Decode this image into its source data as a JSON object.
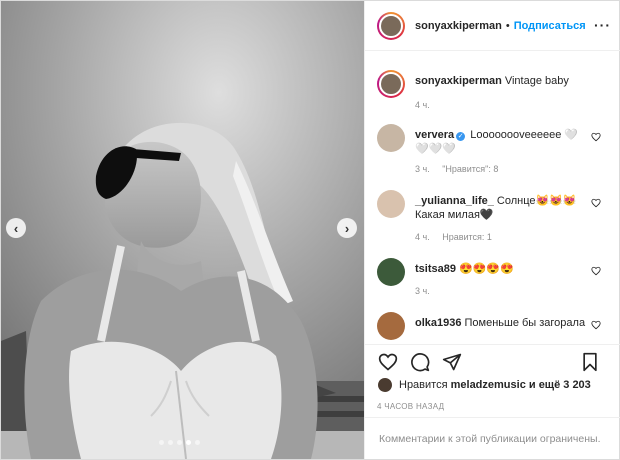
{
  "post": {
    "username": "sonyaxkiperman",
    "separator": "•",
    "follow_label": "Подписаться",
    "more_label": "···",
    "photo": {
      "description_icon": "photo-image",
      "prev_icon": "chevron-left-icon",
      "next_icon": "chevron-right-icon",
      "prev_glyph": "‹",
      "next_glyph": "›",
      "slides_count": 5,
      "active_slide": 4
    }
  },
  "caption": {
    "username": "sonyaxkiperman",
    "text": "Vintage baby",
    "time": "4 ч."
  },
  "comments": [
    {
      "username": "ververa",
      "verified": true,
      "text": "Loooooooveeeeee 🤍 🤍🤍🤍",
      "time": "3 ч.",
      "likes": "\"Нравится\": 8",
      "avatar_color": "#c7b6a4"
    },
    {
      "username": "_yulianna_life_",
      "verified": false,
      "text": "Солнце😻😻😻 Какая милая🖤",
      "time": "4 ч.",
      "likes": "Нравится: 1",
      "avatar_color": "#d9c2ae"
    },
    {
      "username": "tsitsa89",
      "verified": false,
      "text": "😍😍😍😍",
      "time": "3 ч.",
      "likes": "",
      "avatar_color": "#3c5a3a"
    },
    {
      "username": "olka1936",
      "verified": false,
      "text": "Поменьше бы загорала",
      "time": "",
      "likes": "",
      "avatar_color": "#a56a3e"
    }
  ],
  "actions": {
    "like_icon": "heart-icon",
    "comment_icon": "comment-icon",
    "share_icon": "paper-plane-icon",
    "save_icon": "bookmark-icon"
  },
  "likes_line": {
    "prefix": "Нравится",
    "user": "meladzemusic",
    "suffix": "и ещё 3 203"
  },
  "timestamp": "4 ЧАСОВ НАЗАД",
  "footer": {
    "text": "Комментарии к этой публикации ограничены."
  },
  "colors": {
    "link": "#0095f6",
    "muted": "#8e8e8e",
    "text": "#262626",
    "border": "#efefef"
  }
}
